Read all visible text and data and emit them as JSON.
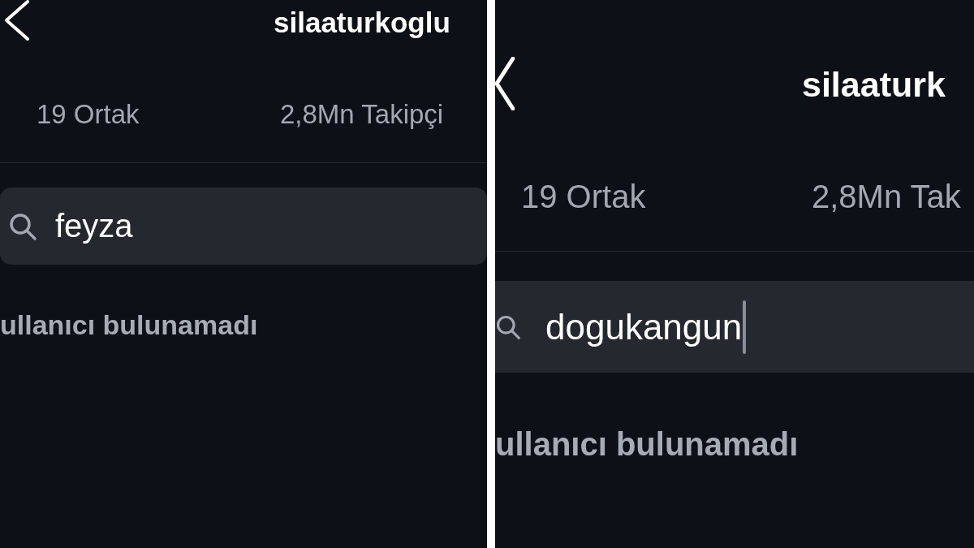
{
  "panels": [
    {
      "title": "silaaturkoglu",
      "stats": [
        {
          "label": "19 Ortak"
        },
        {
          "label": "2,8Mn Takipçi"
        }
      ],
      "search": {
        "value": "feyza",
        "focused": false
      },
      "message": "ullanıcı bulunamadı"
    },
    {
      "title": "silaaturk",
      "stats": [
        {
          "label": "19 Ortak"
        },
        {
          "label": "2,8Mn Tak"
        }
      ],
      "search": {
        "value": "dogukangun",
        "focused": true
      },
      "message": "ullanıcı bulunamadı"
    }
  ]
}
